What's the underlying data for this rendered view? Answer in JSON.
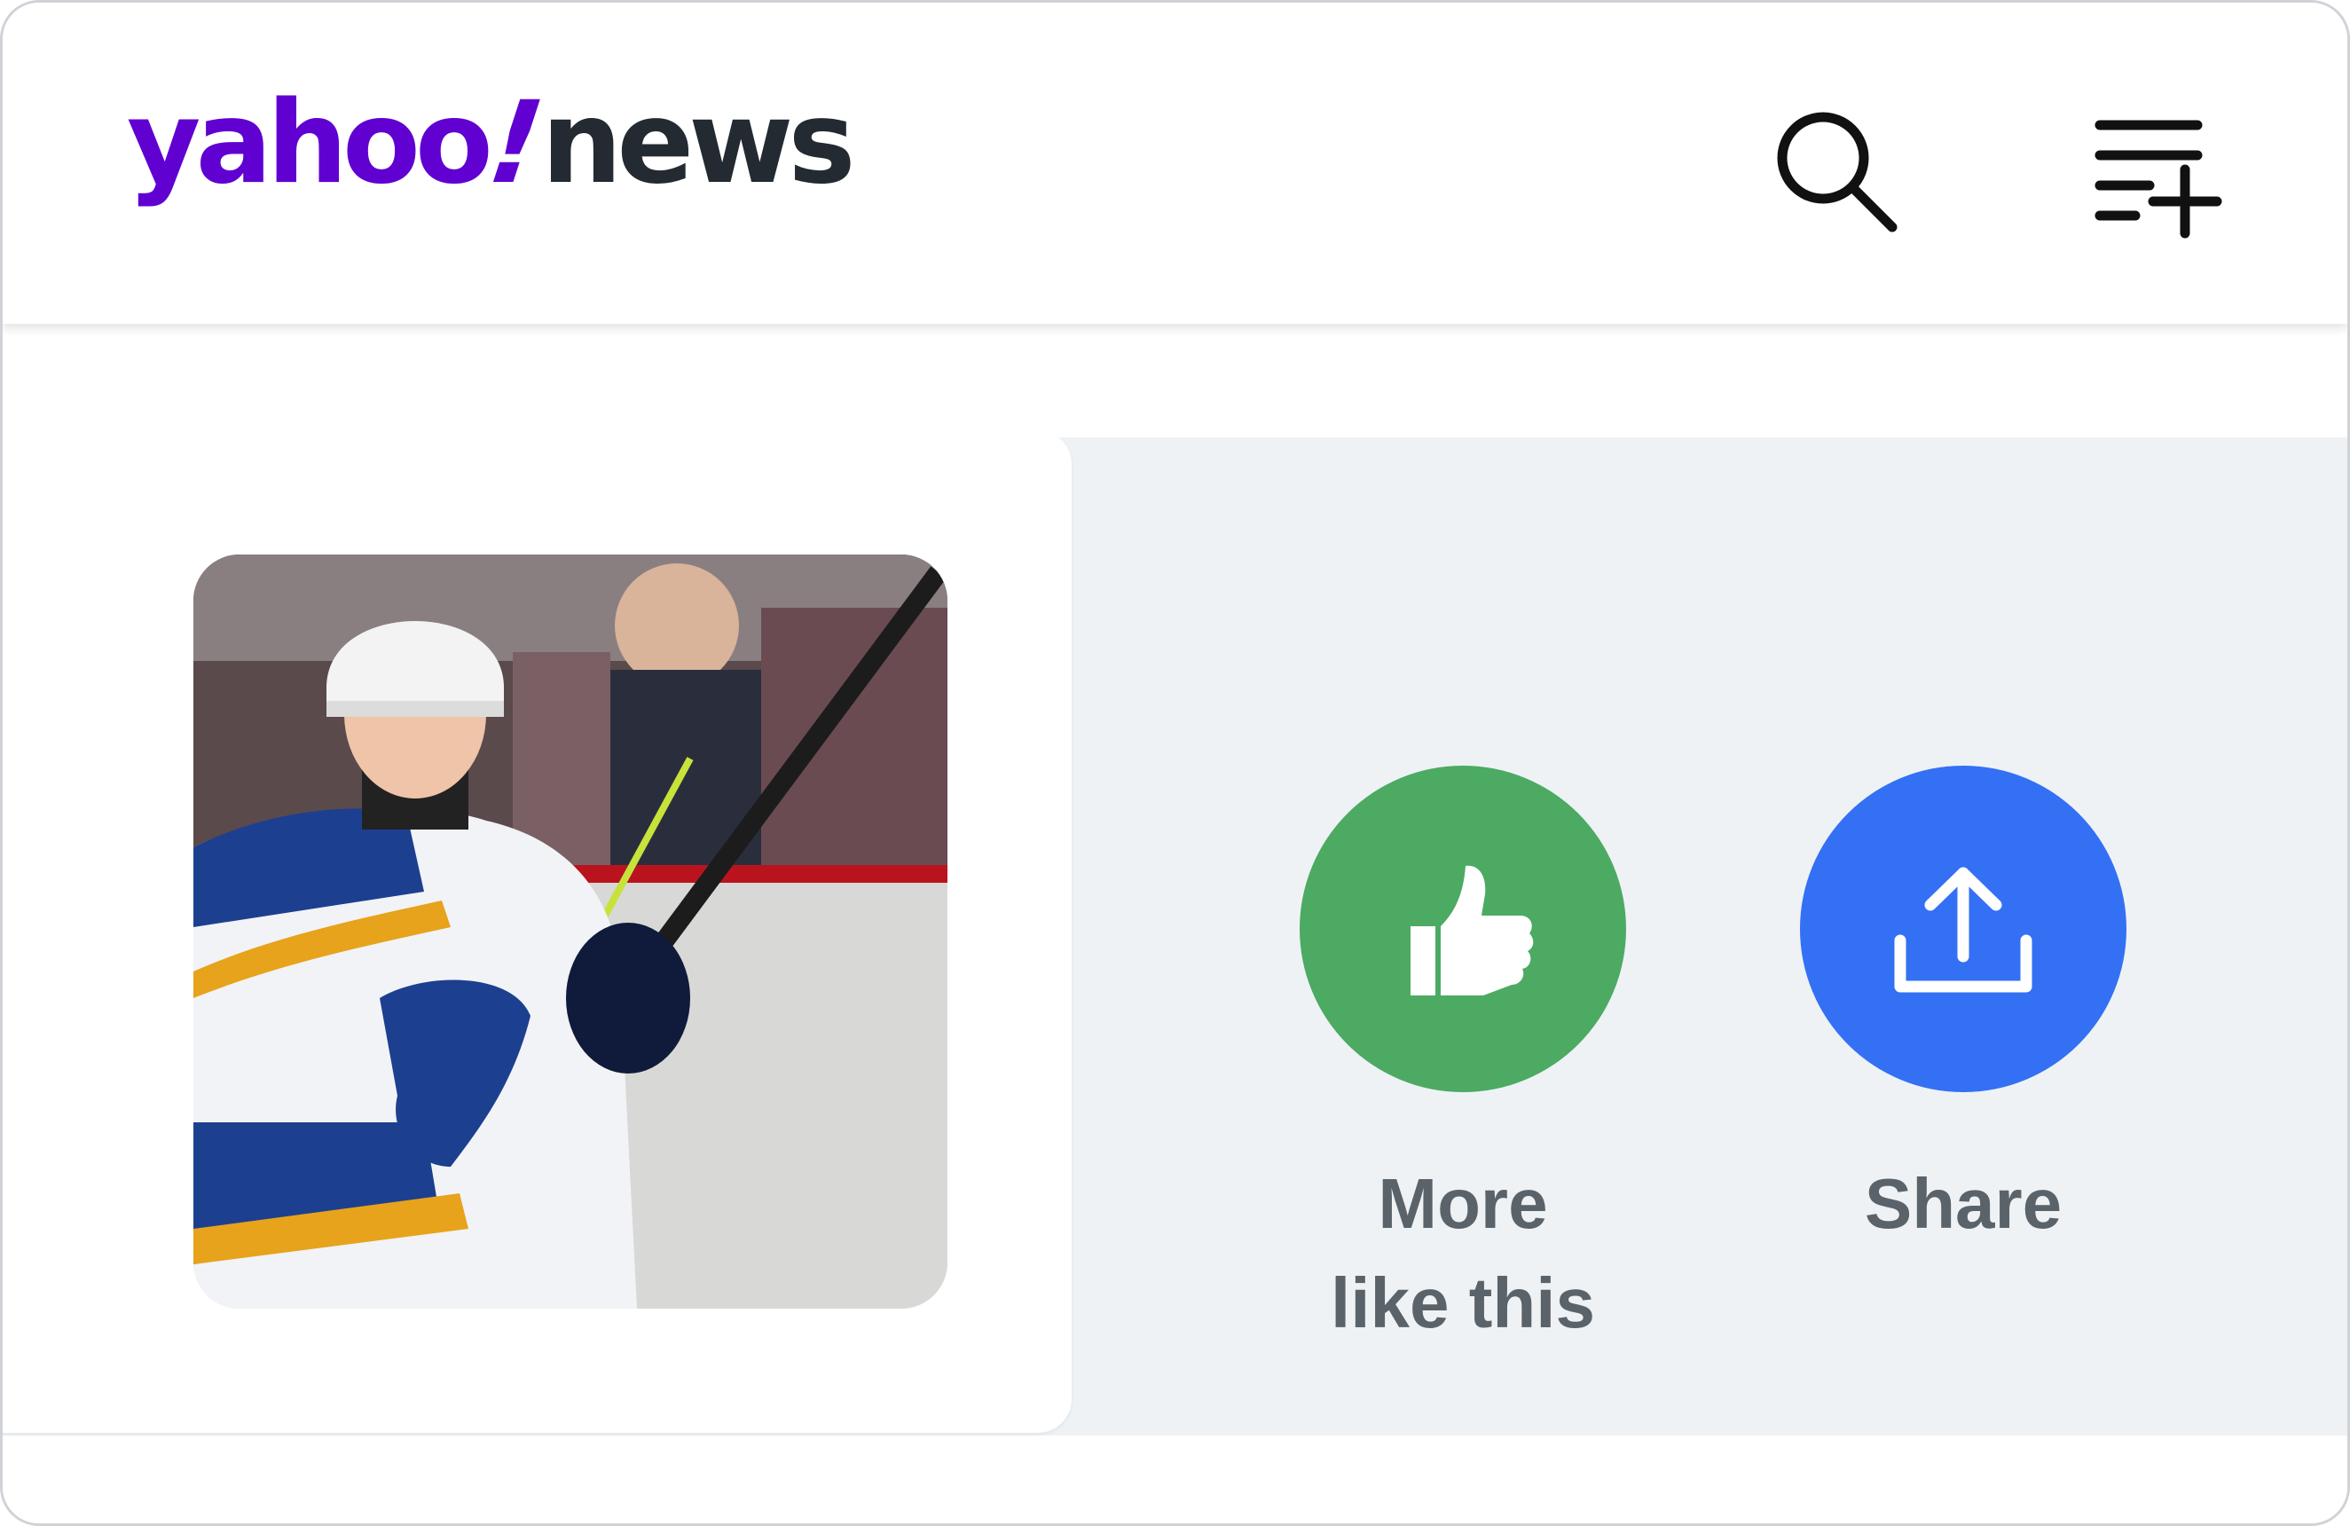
{
  "header": {
    "logo": {
      "brand": "yahoo",
      "bang": "!",
      "product": "news"
    },
    "search_icon": "search-icon",
    "menu_icon": "playlist-add-icon"
  },
  "card": {
    "thumbnail": "hockey-player-thumbnail"
  },
  "actions": {
    "more_like_this": {
      "label": "More\nlike this",
      "icon": "thumbs-up-icon",
      "color": "#4caa63"
    },
    "share": {
      "label": "Share",
      "icon": "share-upload-icon",
      "color": "#3370f4"
    }
  },
  "colors": {
    "brand": "#6001d2",
    "panel_bg": "#eef2f5",
    "label_text": "#5b636a"
  }
}
